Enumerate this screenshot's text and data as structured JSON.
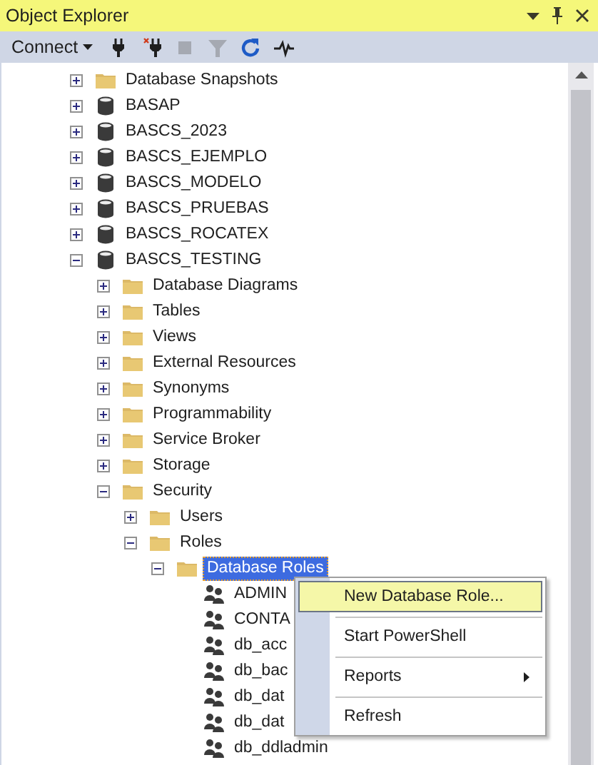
{
  "window": {
    "title": "Object Explorer"
  },
  "toolbar": {
    "connect": "Connect",
    "tools": [
      {
        "kind": "plug",
        "disabled": false
      },
      {
        "kind": "unplug",
        "disabled": false
      },
      {
        "kind": "stop",
        "disabled": true
      },
      {
        "kind": "filter",
        "disabled": true
      },
      {
        "kind": "refresh",
        "disabled": false
      },
      {
        "kind": "activity",
        "disabled": false
      }
    ]
  },
  "tree": [
    {
      "label": "Database Snapshots",
      "kind": "folder",
      "expanded": false,
      "selected": false
    },
    {
      "label": "BASAP",
      "kind": "database",
      "expanded": false,
      "selected": false
    },
    {
      "label": "BASCS_2023",
      "kind": "database",
      "expanded": false,
      "selected": false
    },
    {
      "label": "BASCS_EJEMPLO",
      "kind": "database",
      "expanded": false,
      "selected": false
    },
    {
      "label": "BASCS_MODELO",
      "kind": "database",
      "expanded": false,
      "selected": false
    },
    {
      "label": "BASCS_PRUEBAS",
      "kind": "database",
      "expanded": false,
      "selected": false
    },
    {
      "label": "BASCS_ROCATEX",
      "kind": "database",
      "expanded": false,
      "selected": false
    },
    {
      "label": "BASCS_TESTING",
      "kind": "database",
      "expanded": true,
      "selected": false,
      "children": [
        {
          "label": "Database Diagrams",
          "kind": "folder",
          "expanded": false,
          "selected": false
        },
        {
          "label": "Tables",
          "kind": "folder",
          "expanded": false,
          "selected": false
        },
        {
          "label": "Views",
          "kind": "folder",
          "expanded": false,
          "selected": false
        },
        {
          "label": "External Resources",
          "kind": "folder",
          "expanded": false,
          "selected": false
        },
        {
          "label": "Synonyms",
          "kind": "folder",
          "expanded": false,
          "selected": false
        },
        {
          "label": "Programmability",
          "kind": "folder",
          "expanded": false,
          "selected": false
        },
        {
          "label": "Service Broker",
          "kind": "folder",
          "expanded": false,
          "selected": false
        },
        {
          "label": "Storage",
          "kind": "folder",
          "expanded": false,
          "selected": false
        },
        {
          "label": "Security",
          "kind": "folder",
          "expanded": true,
          "selected": false,
          "children": [
            {
              "label": "Users",
              "kind": "folder",
              "expanded": false,
              "selected": false
            },
            {
              "label": "Roles",
              "kind": "folder",
              "expanded": true,
              "selected": false,
              "children": [
                {
                  "label": "Database Roles",
                  "kind": "folder",
                  "expanded": true,
                  "selected": true,
                  "children": [
                    {
                      "label": "ADMIN",
                      "kind": "role",
                      "selected": false
                    },
                    {
                      "label": "CONTA",
                      "kind": "role",
                      "selected": false
                    },
                    {
                      "label": "db_acc",
                      "kind": "role",
                      "selected": false
                    },
                    {
                      "label": "db_bac",
                      "kind": "role",
                      "selected": false
                    },
                    {
                      "label": "db_dat",
                      "kind": "role",
                      "selected": false
                    },
                    {
                      "label": "db_dat",
                      "kind": "role",
                      "selected": false
                    },
                    {
                      "label": "db_ddladmin",
                      "kind": "role",
                      "selected": false
                    }
                  ]
                }
              ]
            }
          ]
        }
      ]
    }
  ],
  "context_menu": [
    {
      "label": "New Database Role...",
      "kind": "item",
      "selected": true
    },
    {
      "label": "Start PowerShell",
      "kind": "item",
      "selected": false
    },
    {
      "label": "Reports",
      "kind": "submenu",
      "selected": false
    },
    {
      "label": "Refresh",
      "kind": "item",
      "selected": false
    }
  ]
}
